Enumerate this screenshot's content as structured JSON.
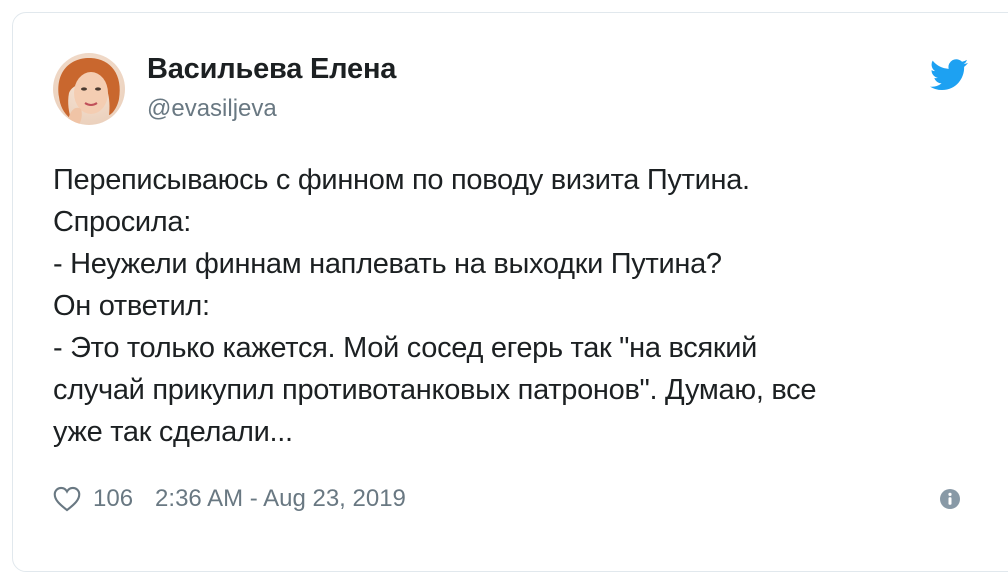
{
  "tweet": {
    "author": {
      "name": "Васильева Елена",
      "handle": "@evasiljeva"
    },
    "text_lines": [
      "Переписываюсь с финном по поводу визита Путина.",
      "Спросила:",
      "- Неужели финнам наплевать на выходки Путина?",
      "Он ответил:",
      "- Это только кажется. Мой сосед егерь так \"на всякий",
      "случай прикупил противотанковых патронов\". Думаю, все",
      "уже так сделали..."
    ],
    "likes": "106",
    "timestamp": "2:36 AM - Aug 23, 2019"
  },
  "icons": {
    "brand": "twitter-bird-icon",
    "like": "heart-icon",
    "info": "info-icon"
  },
  "colors": {
    "twitter_blue": "#1da1f2",
    "text": "#1c2022",
    "secondary": "#697882",
    "border": "#e1e8ed"
  }
}
